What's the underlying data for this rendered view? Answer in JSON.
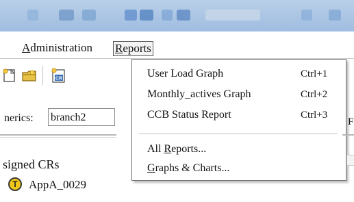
{
  "menubar": {
    "administration": {
      "pre": "",
      "accel": "A",
      "post": "dministration"
    },
    "reports": {
      "pre": "",
      "accel": "R",
      "post": "eports"
    }
  },
  "toolbar": {
    "icons": [
      "document-new-icon",
      "folder-open-icon",
      "cr-document-icon"
    ]
  },
  "generics": {
    "label": "nerics:",
    "value": "branch2"
  },
  "assigned": {
    "label": "signed CRs",
    "items": [
      {
        "badge": "T",
        "text": "AppA_0029"
      }
    ]
  },
  "reports_menu": {
    "items": [
      {
        "label": "User Load Graph",
        "shortcut": "Ctrl+1"
      },
      {
        "label": "Monthly_actives Graph",
        "shortcut": "Ctrl+2"
      },
      {
        "label": "CCB Status Report",
        "shortcut": "Ctrl+3"
      }
    ],
    "all_reports": {
      "pre": "All ",
      "accel": "R",
      "post": "eports..."
    },
    "graphs_charts": {
      "pre": "",
      "accel": "G",
      "post": "raphs & Charts..."
    }
  },
  "right_edge": {
    "glyph": "F"
  },
  "colors": {
    "toolbar_top": "#b9cfe8",
    "badge_yellow": "#f0c81a",
    "menu_border": "#6f6f6f"
  }
}
